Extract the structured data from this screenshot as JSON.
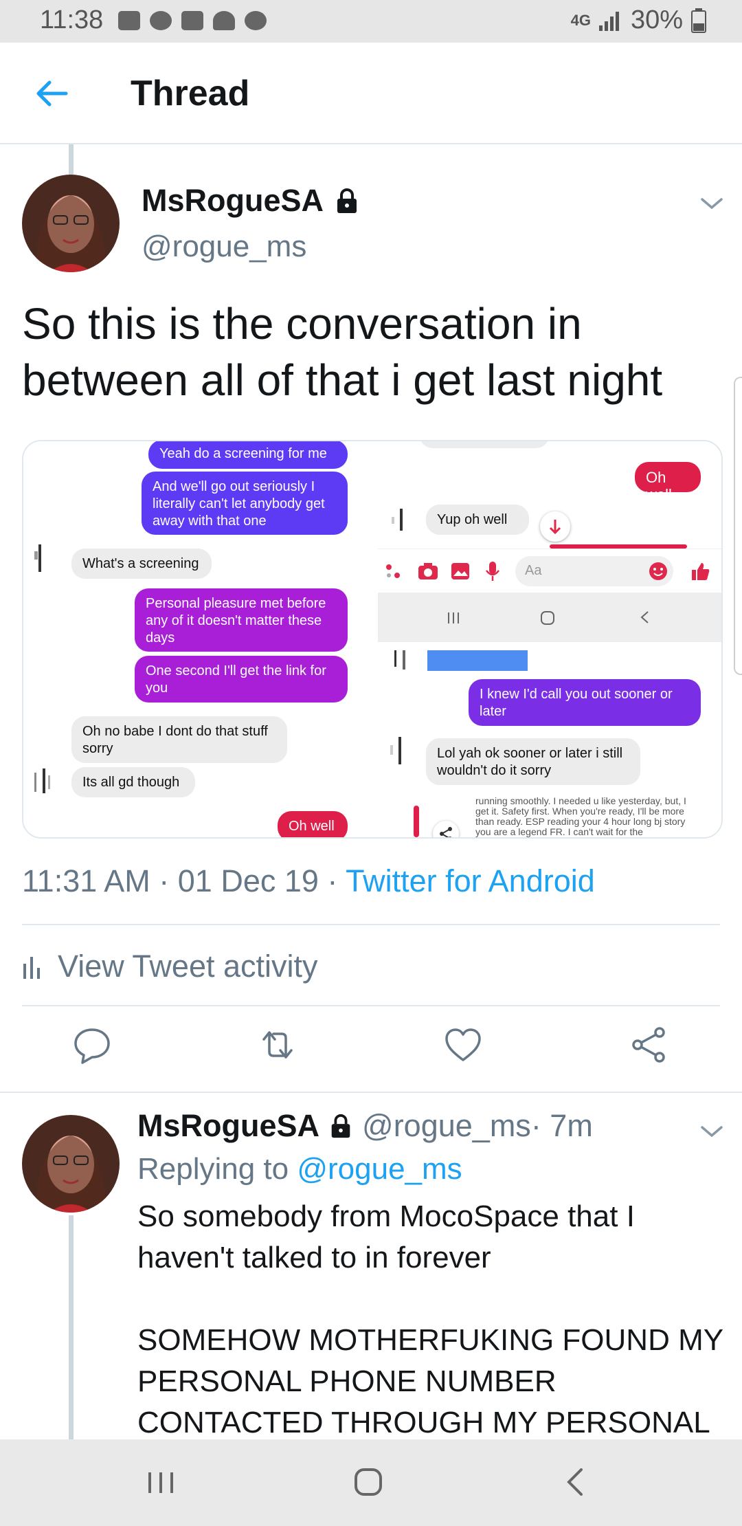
{
  "status_bar": {
    "time": "11:38",
    "network": "4G",
    "battery": "30%"
  },
  "app_bar": {
    "title": "Thread"
  },
  "tweet": {
    "display_name": "MsRogueSA",
    "handle": "@rogue_ms",
    "text": "So this is the conversation in between all of that i get last night",
    "timestamp": "11:31 AM · 01 Dec 19 · ",
    "source": "Twitter for Android",
    "activity_label": "View Tweet activity"
  },
  "media": {
    "left_pane": {
      "messages": [
        {
          "text": "Yeah do a screening for me",
          "style": "blue"
        },
        {
          "text": "And we'll go out seriously I literally can't let anybody get away with that one",
          "style": "blue"
        },
        {
          "text": "What's a screening",
          "style": "gray"
        },
        {
          "text": "Personal pleasure met before any of it doesn't matter these days",
          "style": "purple"
        },
        {
          "text": "One second I'll get the link for you",
          "style": "purple"
        },
        {
          "text": "Oh no babe I dont do that stuff sorry",
          "style": "gray"
        },
        {
          "text": "Its all gd though",
          "style": "gray"
        },
        {
          "text": "Oh well",
          "style": "red"
        }
      ]
    },
    "right_top": {
      "messages": [
        {
          "text": "Oh well",
          "style": "red"
        },
        {
          "text": "Yup oh well",
          "style": "gray"
        }
      ],
      "composer_placeholder": "Aa"
    },
    "right_bottom": {
      "messages": [
        {
          "text": "I knew I'd call you out sooner or later",
          "style": "purple"
        },
        {
          "text": "Lol yah ok sooner or later i still wouldn't do it sorry",
          "style": "gray"
        }
      ],
      "preview_text": "running smoothly. I needed u like yesterday, but, I get it. Safety first. When you're ready, I'll be more than ready. ESP reading your 4 hour long bj story you are a legend FR. I can't wait for the"
    }
  },
  "reply": {
    "display_name": "MsRogueSA",
    "handle": "@rogue_ms",
    "time": " · 7m",
    "replying_prefix": "Replying to ",
    "replying_to": "@rogue_ms",
    "text": "So somebody from MocoSpace that I haven't talked to in forever\n\nSOMEHOW MOTHERFUKING FOUND MY PERSONAL PHONE NUMBER CONTACTED THROUGH MY PERSONAL"
  },
  "colors": {
    "twitter_blue": "#1da1f2",
    "gray_text": "#657786",
    "messenger_blue": "#5d3af3",
    "messenger_purple": "#a91fd8",
    "messenger_red": "#dd1f4a"
  }
}
